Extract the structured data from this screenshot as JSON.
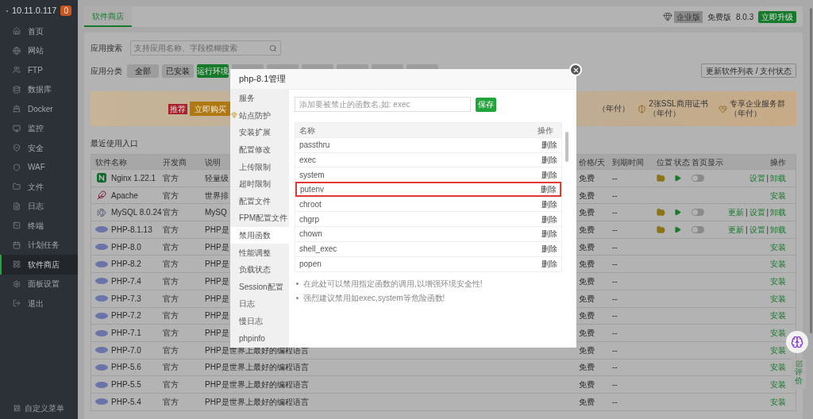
{
  "sidebar": {
    "host": "10.11.0.117",
    "badge": "0",
    "items": [
      {
        "label": "首页",
        "selected": false
      },
      {
        "label": "网站",
        "selected": false
      },
      {
        "label": "FTP",
        "selected": false
      },
      {
        "label": "数据库",
        "selected": false
      },
      {
        "label": "Docker",
        "selected": false
      },
      {
        "label": "监控",
        "selected": false
      },
      {
        "label": "安全",
        "selected": false
      },
      {
        "label": "WAF",
        "selected": false
      },
      {
        "label": "文件",
        "selected": false
      },
      {
        "label": "日志",
        "selected": false
      },
      {
        "label": "终端",
        "selected": false
      },
      {
        "label": "计划任务",
        "selected": false
      },
      {
        "label": "软件商店",
        "selected": true
      },
      {
        "label": "面板设置",
        "selected": false
      },
      {
        "label": "退出",
        "selected": false
      }
    ],
    "footer": "自定义菜单"
  },
  "topbar": {
    "tab": "软件商店",
    "edition_badge": "企业版",
    "edition": "免费版",
    "version": "8.0.3",
    "upgrade": "立即升级"
  },
  "search": {
    "label": "应用搜索",
    "placeholder": "支持应用名称、字段模糊搜索"
  },
  "categories": {
    "label": "应用分类",
    "items": [
      {
        "label": "全部",
        "selected": false
      },
      {
        "label": "已安装",
        "selected": false
      },
      {
        "label": "运行环境",
        "selected": true
      },
      {
        "selected": false
      },
      {
        "selected": false
      },
      {
        "selected": false
      },
      {
        "selected": false
      },
      {
        "selected": false
      },
      {
        "selected": false
      }
    ],
    "refresh": "更新软件列表 / 支付状态"
  },
  "banner": {
    "ribbon": "推荐",
    "buy": "立即购买",
    "perks": [
      "（年付）",
      "2张SSL商用证书（年付）",
      "专享企业服务群（年付）"
    ]
  },
  "recent": "最近使用入口",
  "table": {
    "columns": [
      "软件名称",
      "开发商",
      "说明",
      "价格/天",
      "到期时间",
      "位置",
      "状态",
      "首页显示",
      "操作"
    ],
    "separator": "|",
    "rows": [
      {
        "kind": "nginx",
        "name": "Nginx 1.22.1",
        "dev": "官方",
        "desc": "轻量级",
        "price": "免费",
        "expiry": "--",
        "home_display": false,
        "actions": [
          "设置",
          "卸载"
        ]
      },
      {
        "kind": "apache",
        "name": "Apache",
        "dev": "官方",
        "desc": "世界排",
        "price": "免费",
        "expiry": "--",
        "actions": [
          "安装"
        ]
      },
      {
        "kind": "mysql",
        "name": "MySQL 8.0.24",
        "dev": "官方",
        "desc": "MySQ",
        "price": "免费",
        "expiry": "--",
        "home_display": false,
        "actions": [
          "更新",
          "设置",
          "卸载"
        ]
      },
      {
        "kind": "php",
        "name": "PHP-8.1.13",
        "dev": "官方",
        "desc": "PHP是",
        "price": "免费",
        "expiry": "--",
        "home_display": false,
        "actions": [
          "更新",
          "设置",
          "卸载"
        ]
      },
      {
        "kind": "php",
        "name": "PHP-8.0",
        "dev": "官方",
        "desc": "PHP是",
        "price": "免费",
        "expiry": "--",
        "actions": [
          "安装"
        ]
      },
      {
        "kind": "php",
        "name": "PHP-8.2",
        "dev": "官方",
        "desc": "PHP是",
        "price": "免费",
        "expiry": "--",
        "actions": [
          "安装"
        ]
      },
      {
        "kind": "php",
        "name": "PHP-7.4",
        "dev": "官方",
        "desc": "PHP是",
        "price": "免费",
        "expiry": "--",
        "actions": [
          "安装"
        ]
      },
      {
        "kind": "php",
        "name": "PHP-7.3",
        "dev": "官方",
        "desc": "PHP是",
        "price": "免费",
        "expiry": "--",
        "actions": [
          "安装"
        ]
      },
      {
        "kind": "php",
        "name": "PHP-7.2",
        "dev": "官方",
        "desc": "PHP是",
        "price": "免费",
        "expiry": "--",
        "actions": [
          "安装"
        ]
      },
      {
        "kind": "php",
        "name": "PHP-7.1",
        "dev": "官方",
        "desc": "PHP是",
        "price": "免费",
        "expiry": "--",
        "actions": [
          "安装"
        ]
      },
      {
        "kind": "php",
        "name": "PHP-7.0",
        "dev": "官方",
        "desc": "PHP是世界上最好的编程语言",
        "price": "免费",
        "expiry": "--",
        "actions": [
          "安装"
        ]
      },
      {
        "kind": "php",
        "name": "PHP-5.6",
        "dev": "官方",
        "desc": "PHP是世界上最好的编程语言",
        "price": "免费",
        "expiry": "--",
        "actions": [
          "安装"
        ]
      },
      {
        "kind": "php",
        "name": "PHP-5.5",
        "dev": "官方",
        "desc": "PHP是世界上最好的编程语言",
        "price": "免费",
        "expiry": "--",
        "actions": [
          "安装"
        ]
      },
      {
        "kind": "php",
        "name": "PHP-5.4",
        "dev": "官方",
        "desc": "PHP是世界上最好的编程语言",
        "price": "免费",
        "expiry": "--",
        "actions": [
          "安装"
        ]
      }
    ]
  },
  "side_tools": {
    "review": "评价"
  },
  "modal": {
    "title": "php-8.1管理",
    "nav": [
      {
        "label": "服务",
        "selected": false,
        "premium": false
      },
      {
        "label": "站点防护",
        "selected": false,
        "premium": true
      },
      {
        "label": "安装扩展",
        "selected": false,
        "premium": false
      },
      {
        "label": "配置修改",
        "selected": false,
        "premium": false
      },
      {
        "label": "上传限制",
        "selected": false,
        "premium": false
      },
      {
        "label": "超时限制",
        "selected": false,
        "premium": false
      },
      {
        "label": "配置文件",
        "selected": false,
        "premium": false
      },
      {
        "label": "FPM配置文件",
        "selected": false,
        "premium": false
      },
      {
        "label": "禁用函数",
        "selected": true,
        "premium": false
      },
      {
        "label": "性能调整",
        "selected": false,
        "premium": false
      },
      {
        "label": "负载状态",
        "selected": false,
        "premium": false
      },
      {
        "label": "Session配置",
        "selected": false,
        "premium": false
      },
      {
        "label": "日志",
        "selected": false,
        "premium": false
      },
      {
        "label": "慢日志",
        "selected": false,
        "premium": false
      },
      {
        "label": "phpinfo",
        "selected": false,
        "premium": false
      }
    ],
    "input_placeholder": "添加要被禁止的函数名,如: exec",
    "save": "保存",
    "columns": [
      "名称",
      "操作"
    ],
    "functions": [
      {
        "name": "passthru",
        "action": "删除",
        "highlighted": false
      },
      {
        "name": "exec",
        "action": "删除",
        "highlighted": false
      },
      {
        "name": "system",
        "action": "删除",
        "highlighted": false
      },
      {
        "name": "putenv",
        "action": "删除",
        "highlighted": true
      },
      {
        "name": "chroot",
        "action": "删除",
        "highlighted": false
      },
      {
        "name": "chgrp",
        "action": "删除",
        "highlighted": false
      },
      {
        "name": "chown",
        "action": "删除",
        "highlighted": false
      },
      {
        "name": "shell_exec",
        "action": "删除",
        "highlighted": false
      },
      {
        "name": "popen",
        "action": "删除",
        "highlighted": false
      }
    ],
    "notes": [
      "在此处可以禁用指定函数的调用,以增强环境安全性!",
      "强烈建议禁用如exec,system等危险函数!"
    ]
  }
}
